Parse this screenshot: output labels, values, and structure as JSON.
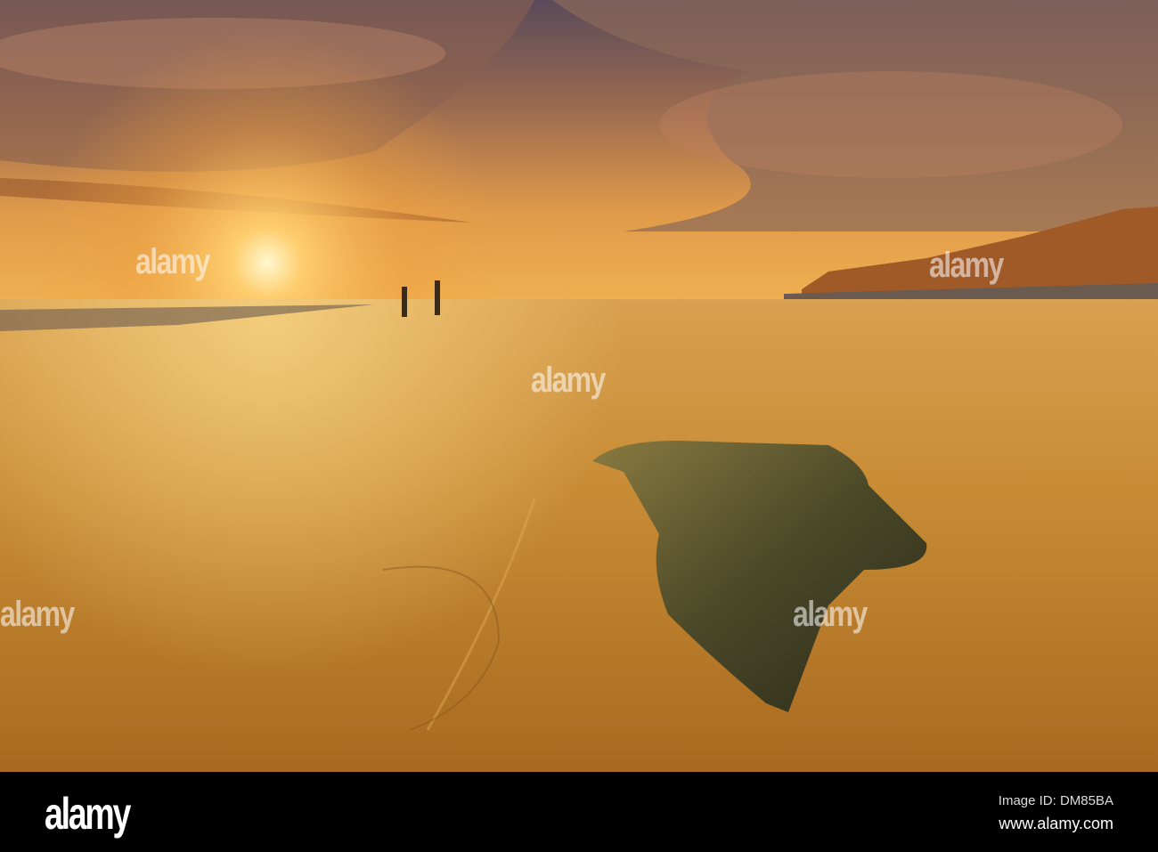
{
  "photo": {
    "subject": "Sunset over sandy beach with rock",
    "watermark": "alamy",
    "colors": {
      "sky_top": "#4a4a6a",
      "sun": "#fff3c0",
      "sand": "#c8892e",
      "rock": "#3a3a22"
    }
  },
  "footer": {
    "logo": "alamy",
    "image_id": "Image ID: DM85BA",
    "url": "www.alamy.com"
  }
}
